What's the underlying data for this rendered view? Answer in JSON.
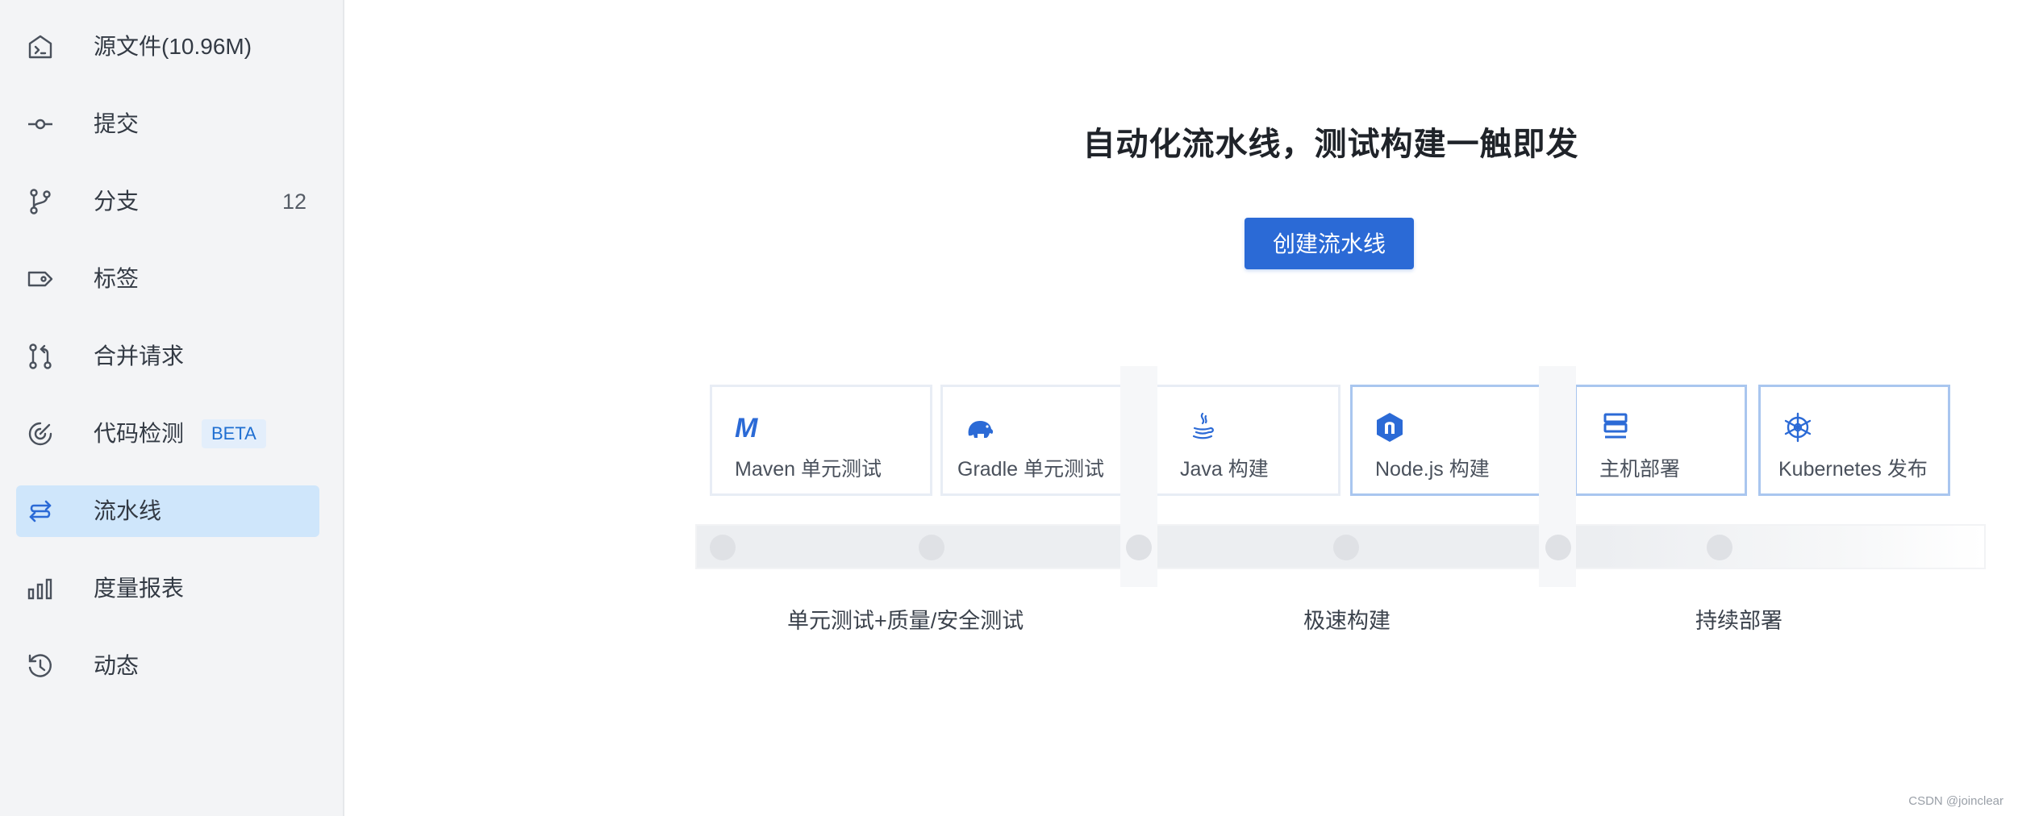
{
  "sidebar": {
    "items": [
      {
        "label": "源文件(10.96M)",
        "icon": "code-file-icon"
      },
      {
        "label": "提交",
        "icon": "commit-icon"
      },
      {
        "label": "分支",
        "icon": "branch-icon",
        "count": "12"
      },
      {
        "label": "标签",
        "icon": "tag-icon"
      },
      {
        "label": "合并请求",
        "icon": "merge-request-icon"
      },
      {
        "label": "代码检测",
        "icon": "code-scan-icon",
        "badge": "BETA"
      },
      {
        "label": "流水线",
        "icon": "pipeline-icon",
        "active": true
      },
      {
        "label": "度量报表",
        "icon": "bar-chart-icon"
      },
      {
        "label": "动态",
        "icon": "history-icon"
      }
    ]
  },
  "main": {
    "headline": "自动化流水线，测试构建一触即发",
    "create_button": "创建流水线",
    "cards": [
      {
        "label": "Maven 单元测试",
        "icon": "maven-icon"
      },
      {
        "label": "Gradle 单元测试",
        "icon": "gradle-elephant-icon"
      },
      {
        "label": "Java 构建",
        "icon": "java-icon"
      },
      {
        "label": "Node.js 构建",
        "icon": "nodejs-icon"
      },
      {
        "label": "主机部署",
        "icon": "server-icon"
      },
      {
        "label": "Kubernetes 发布",
        "icon": "kubernetes-icon"
      }
    ],
    "stages": [
      "单元测试+质量/安全测试",
      "极速构建",
      "持续部署"
    ]
  },
  "colors": {
    "accent": "#2b6ad6",
    "active_nav_bg": "#cfe6fb",
    "sidebar_bg": "#f3f4f6"
  },
  "watermark": "CSDN @joinclear"
}
